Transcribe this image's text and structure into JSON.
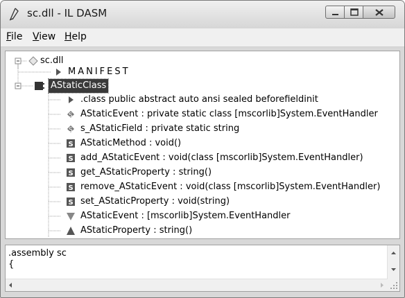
{
  "window": {
    "title": "sc.dll - IL DASM"
  },
  "menu": [
    {
      "label": "File",
      "access": "F",
      "rest": "ile"
    },
    {
      "label": "View",
      "access": "V",
      "rest": "iew"
    },
    {
      "label": "Help",
      "access": "H",
      "rest": "elp"
    }
  ],
  "tree": {
    "root": "sc.dll",
    "manifest": "MANIFEST",
    "class": "AStaticClass",
    "members": [
      {
        "icon": "class-info-icon",
        "text": ".class public abstract auto ansi sealed beforefieldinit"
      },
      {
        "icon": "static-field-icon",
        "text": "AStaticEvent : private static class [mscorlib]System.EventHandler"
      },
      {
        "icon": "static-field-icon",
        "text": "s_AStaticField : private static string"
      },
      {
        "icon": "static-method-icon",
        "text": "AStaticMethod : void()"
      },
      {
        "icon": "static-method-icon",
        "text": "add_AStaticEvent : void(class [mscorlib]System.EventHandler)"
      },
      {
        "icon": "static-method-icon",
        "text": "get_AStaticProperty : string()"
      },
      {
        "icon": "static-method-icon",
        "text": "remove_AStaticEvent : void(class [mscorlib]System.EventHandler)"
      },
      {
        "icon": "static-method-icon",
        "text": "set_AStaticProperty : void(string)"
      },
      {
        "icon": "event-icon",
        "text": "AStaticEvent : [mscorlib]System.EventHandler"
      },
      {
        "icon": "property-icon",
        "text": "AStaticProperty : string()"
      }
    ]
  },
  "il_pane": {
    "lines": [
      ".assembly sc",
      "{"
    ]
  }
}
